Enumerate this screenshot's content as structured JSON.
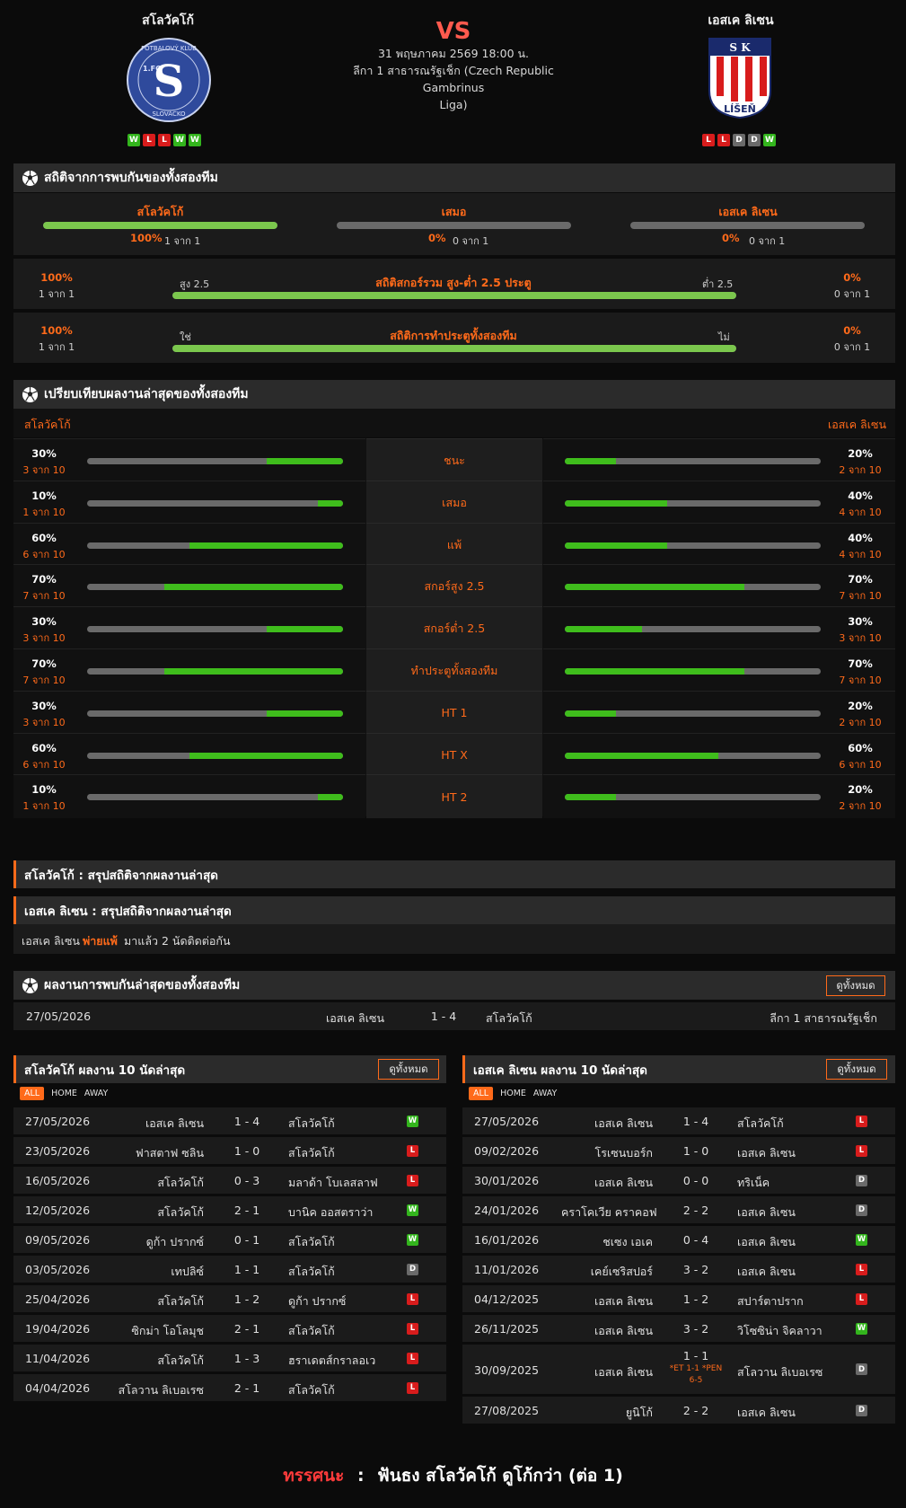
{
  "header": {
    "home_name": "สโลวัคโก้",
    "away_name": "เอสเค ลิเซน",
    "vs": "VS",
    "datetime": "31 พฤษภาคม 2569 18:00 น.",
    "league_line1": "ลีกา 1 สาธารณรัฐเช็ก (Czech Republic Gambrinus",
    "league_line2": "Liga)",
    "home_form": [
      "W",
      "L",
      "L",
      "W",
      "W"
    ],
    "away_form": [
      "L",
      "L",
      "D",
      "D",
      "W"
    ],
    "home_logo": {
      "top": "FOTBALOVÝ KLUB",
      "left": "1.FC",
      "letter": "S",
      "bottom": "SLOVÁCKO"
    },
    "away_logo": {
      "top": "S K",
      "bottom": "LÍŠEŇ"
    }
  },
  "h2h_stats": {
    "title": "สถิติจากการพบกันของทั้งสองทีม",
    "home": {
      "label": "สโลวัคโก้",
      "pct": "100%",
      "count": "1 จาก 1",
      "fill": 1
    },
    "draw": {
      "label": "เสมอ",
      "pct": "0%",
      "count": "0 จาก 1",
      "fill": 0
    },
    "away": {
      "label": "เอสเค ลิเซน",
      "pct": "0%",
      "count": "0 จาก 1",
      "fill": 0
    },
    "ou": {
      "title": "สถิติสกอร์รวม สูง-ต่ำ 2.5 ประตู",
      "left_label": "สูง 2.5",
      "right_label": "ต่ำ 2.5",
      "left_pct": "100%",
      "left_count": "1 จาก 1",
      "right_pct": "0%",
      "right_count": "0 จาก 1",
      "fill": 1
    },
    "btts": {
      "title": "สถิติการทำประตูทั้งสองทีม",
      "left_label": "ใช่",
      "right_label": "ไม่",
      "left_pct": "100%",
      "left_count": "1 จาก 1",
      "right_pct": "0%",
      "right_count": "0 จาก 1",
      "fill": 1
    }
  },
  "compare": {
    "title": "เปรียบเทียบผลงานล่าสุดของทั้งสองทีม",
    "home_name": "สโลวัคโก้",
    "away_name": "เอสเค ลิเซน",
    "rows": [
      {
        "label": "ชนะ",
        "home_pct": "30%",
        "home_count": "3 จาก 10",
        "home_val": 0.3,
        "away_pct": "20%",
        "away_count": "2 จาก 10",
        "away_val": 0.2
      },
      {
        "label": "เสมอ",
        "home_pct": "10%",
        "home_count": "1 จาก 10",
        "home_val": 0.1,
        "away_pct": "40%",
        "away_count": "4 จาก 10",
        "away_val": 0.4
      },
      {
        "label": "แพ้",
        "home_pct": "60%",
        "home_count": "6 จาก 10",
        "home_val": 0.6,
        "away_pct": "40%",
        "away_count": "4 จาก 10",
        "away_val": 0.4
      },
      {
        "label": "สกอร์สูง 2.5",
        "home_pct": "70%",
        "home_count": "7 จาก 10",
        "home_val": 0.7,
        "away_pct": "70%",
        "away_count": "7 จาก 10",
        "away_val": 0.7
      },
      {
        "label": "สกอร์ต่ำ 2.5",
        "home_pct": "30%",
        "home_count": "3 จาก 10",
        "home_val": 0.3,
        "away_pct": "30%",
        "away_count": "3 จาก 10",
        "away_val": 0.3
      },
      {
        "label": "ทำประตูทั้งสองทีม",
        "home_pct": "70%",
        "home_count": "7 จาก 10",
        "home_val": 0.7,
        "away_pct": "70%",
        "away_count": "7 จาก 10",
        "away_val": 0.7
      },
      {
        "label": "HT 1",
        "home_pct": "30%",
        "home_count": "3 จาก 10",
        "home_val": 0.3,
        "away_pct": "20%",
        "away_count": "2 จาก 10",
        "away_val": 0.2
      },
      {
        "label": "HT X",
        "home_pct": "60%",
        "home_count": "6 จาก 10",
        "home_val": 0.6,
        "away_pct": "60%",
        "away_count": "6 จาก 10",
        "away_val": 0.6
      },
      {
        "label": "HT 2",
        "home_pct": "10%",
        "home_count": "1 จาก 10",
        "home_val": 0.1,
        "away_pct": "20%",
        "away_count": "2 จาก 10",
        "away_val": 0.2
      }
    ]
  },
  "summary": {
    "home_title": "สโลวัคโก้ : สรุปสถิติจากผลงานล่าสุด",
    "away_title": "เอสเค ลิเซน : สรุปสถิติจากผลงานล่าสุด",
    "away_note_team": "เอสเค ลิเซน",
    "away_note_hl": "พ่ายแพ้",
    "away_note_rest": "มาแล้ว 2 นัดติดต่อกัน"
  },
  "h2h_results": {
    "title": "ผลงานการพบกันล่าสุดของทั้งสองทีม",
    "view_all": "ดูทั้งหมด",
    "date": "27/05/2026",
    "home": "เอสเค ลิเซน",
    "score": "1 - 4",
    "away": "สโลวัคโก้",
    "league": "ลีกา 1 สาธารณรัฐเช็ก"
  },
  "home_last": {
    "title": "สโลวัคโก้ ผลงาน 10 นัดล่าสุด",
    "view_all": "ดูทั้งหมด",
    "tabs": [
      "ALL",
      "HOME",
      "AWAY"
    ],
    "rows": [
      {
        "date": "27/05/2026",
        "home": "เอสเค ลิเซน",
        "score": "1 - 4",
        "away": "สโลวัคโก้",
        "res": "W"
      },
      {
        "date": "23/05/2026",
        "home": "ฟาสตาฟ ซลิน",
        "score": "1 - 0",
        "away": "สโลวัคโก้",
        "res": "L"
      },
      {
        "date": "16/05/2026",
        "home": "สโลวัคโก้",
        "score": "0 - 3",
        "away": "มลาด้า โบเลสลาฟ",
        "res": "L"
      },
      {
        "date": "12/05/2026",
        "home": "สโลวัคโก้",
        "score": "2 - 1",
        "away": "บานิค ออสตราว่า",
        "res": "W"
      },
      {
        "date": "09/05/2026",
        "home": "ดูก้า ปรากซ์",
        "score": "0 - 1",
        "away": "สโลวัคโก้",
        "res": "W"
      },
      {
        "date": "03/05/2026",
        "home": "เทปลิซ์",
        "score": "1 - 1",
        "away": "สโลวัคโก้",
        "res": "D"
      },
      {
        "date": "25/04/2026",
        "home": "สโลวัคโก้",
        "score": "1 - 2",
        "away": "ดูก้า ปรากซ์",
        "res": "L"
      },
      {
        "date": "19/04/2026",
        "home": "ซิกม่า โอโลมุช",
        "score": "2 - 1",
        "away": "สโลวัคโก้",
        "res": "L"
      },
      {
        "date": "11/04/2026",
        "home": "สโลวัคโก้",
        "score": "1 - 3",
        "away": "ฮราเดตส์กราลอเว",
        "res": "L"
      },
      {
        "date": "04/04/2026",
        "home": "สโลวาน ลิเบอเรซ",
        "score": "2 - 1",
        "away": "สโลวัคโก้",
        "res": "L"
      }
    ]
  },
  "away_last": {
    "title": "เอสเค ลิเซน ผลงาน 10 นัดล่าสุด",
    "view_all": "ดูทั้งหมด",
    "tabs": [
      "ALL",
      "HOME",
      "AWAY"
    ],
    "rows": [
      {
        "date": "27/05/2026",
        "home": "เอสเค ลิเซน",
        "score": "1 - 4",
        "away": "สโลวัคโก้",
        "res": "L"
      },
      {
        "date": "09/02/2026",
        "home": "โรเซนบอร์ก",
        "score": "1 - 0",
        "away": "เอสเค ลิเซน",
        "res": "L"
      },
      {
        "date": "30/01/2026",
        "home": "เอสเค ลิเซน",
        "score": "0 - 0",
        "away": "ทริเน็ค",
        "res": "D"
      },
      {
        "date": "24/01/2026",
        "home": "คราโคเวีย คราคอฟ",
        "score": "2 - 2",
        "away": "เอสเค ลิเซน",
        "res": "D"
      },
      {
        "date": "16/01/2026",
        "home": "ชเซง เอเค",
        "score": "0 - 4",
        "away": "เอสเค ลิเซน",
        "res": "W"
      },
      {
        "date": "11/01/2026",
        "home": "เคย์เซริสปอร์",
        "score": "3 - 2",
        "away": "เอสเค ลิเซน",
        "res": "L"
      },
      {
        "date": "04/12/2025",
        "home": "เอสเค ลิเซน",
        "score": "1 - 2",
        "away": "สปาร์ตาปราก",
        "res": "L"
      },
      {
        "date": "26/11/2025",
        "home": "เอสเค ลิเซน",
        "score": "3 - 2",
        "away": "วิโซซิน่า จิคลาวา",
        "res": "W"
      },
      {
        "date": "30/09/2025",
        "home": "เอสเค ลิเซน",
        "score": "1 - 1",
        "away": "สโลวาน ลิเบอเรซ",
        "res": "D",
        "note1": "*ET 1-1 *PEN",
        "note2": "6-5"
      },
      {
        "date": "27/08/2025",
        "home": "ยูนิโก้",
        "score": "2 - 2",
        "away": "เอสเค ลิเซน",
        "res": "D"
      }
    ]
  },
  "prediction": {
    "label": "ทรรศนะ",
    "sep": ":",
    "text": "ฟันธง สโลวัคโก้ ดูโก้กว่า (ต่อ 1)"
  },
  "colors": {
    "accent": "#ff6a1a",
    "win": "#33b51d",
    "loss": "#d81c1c",
    "draw": "#6a6a6a",
    "bar_green": "#7bc74d"
  }
}
